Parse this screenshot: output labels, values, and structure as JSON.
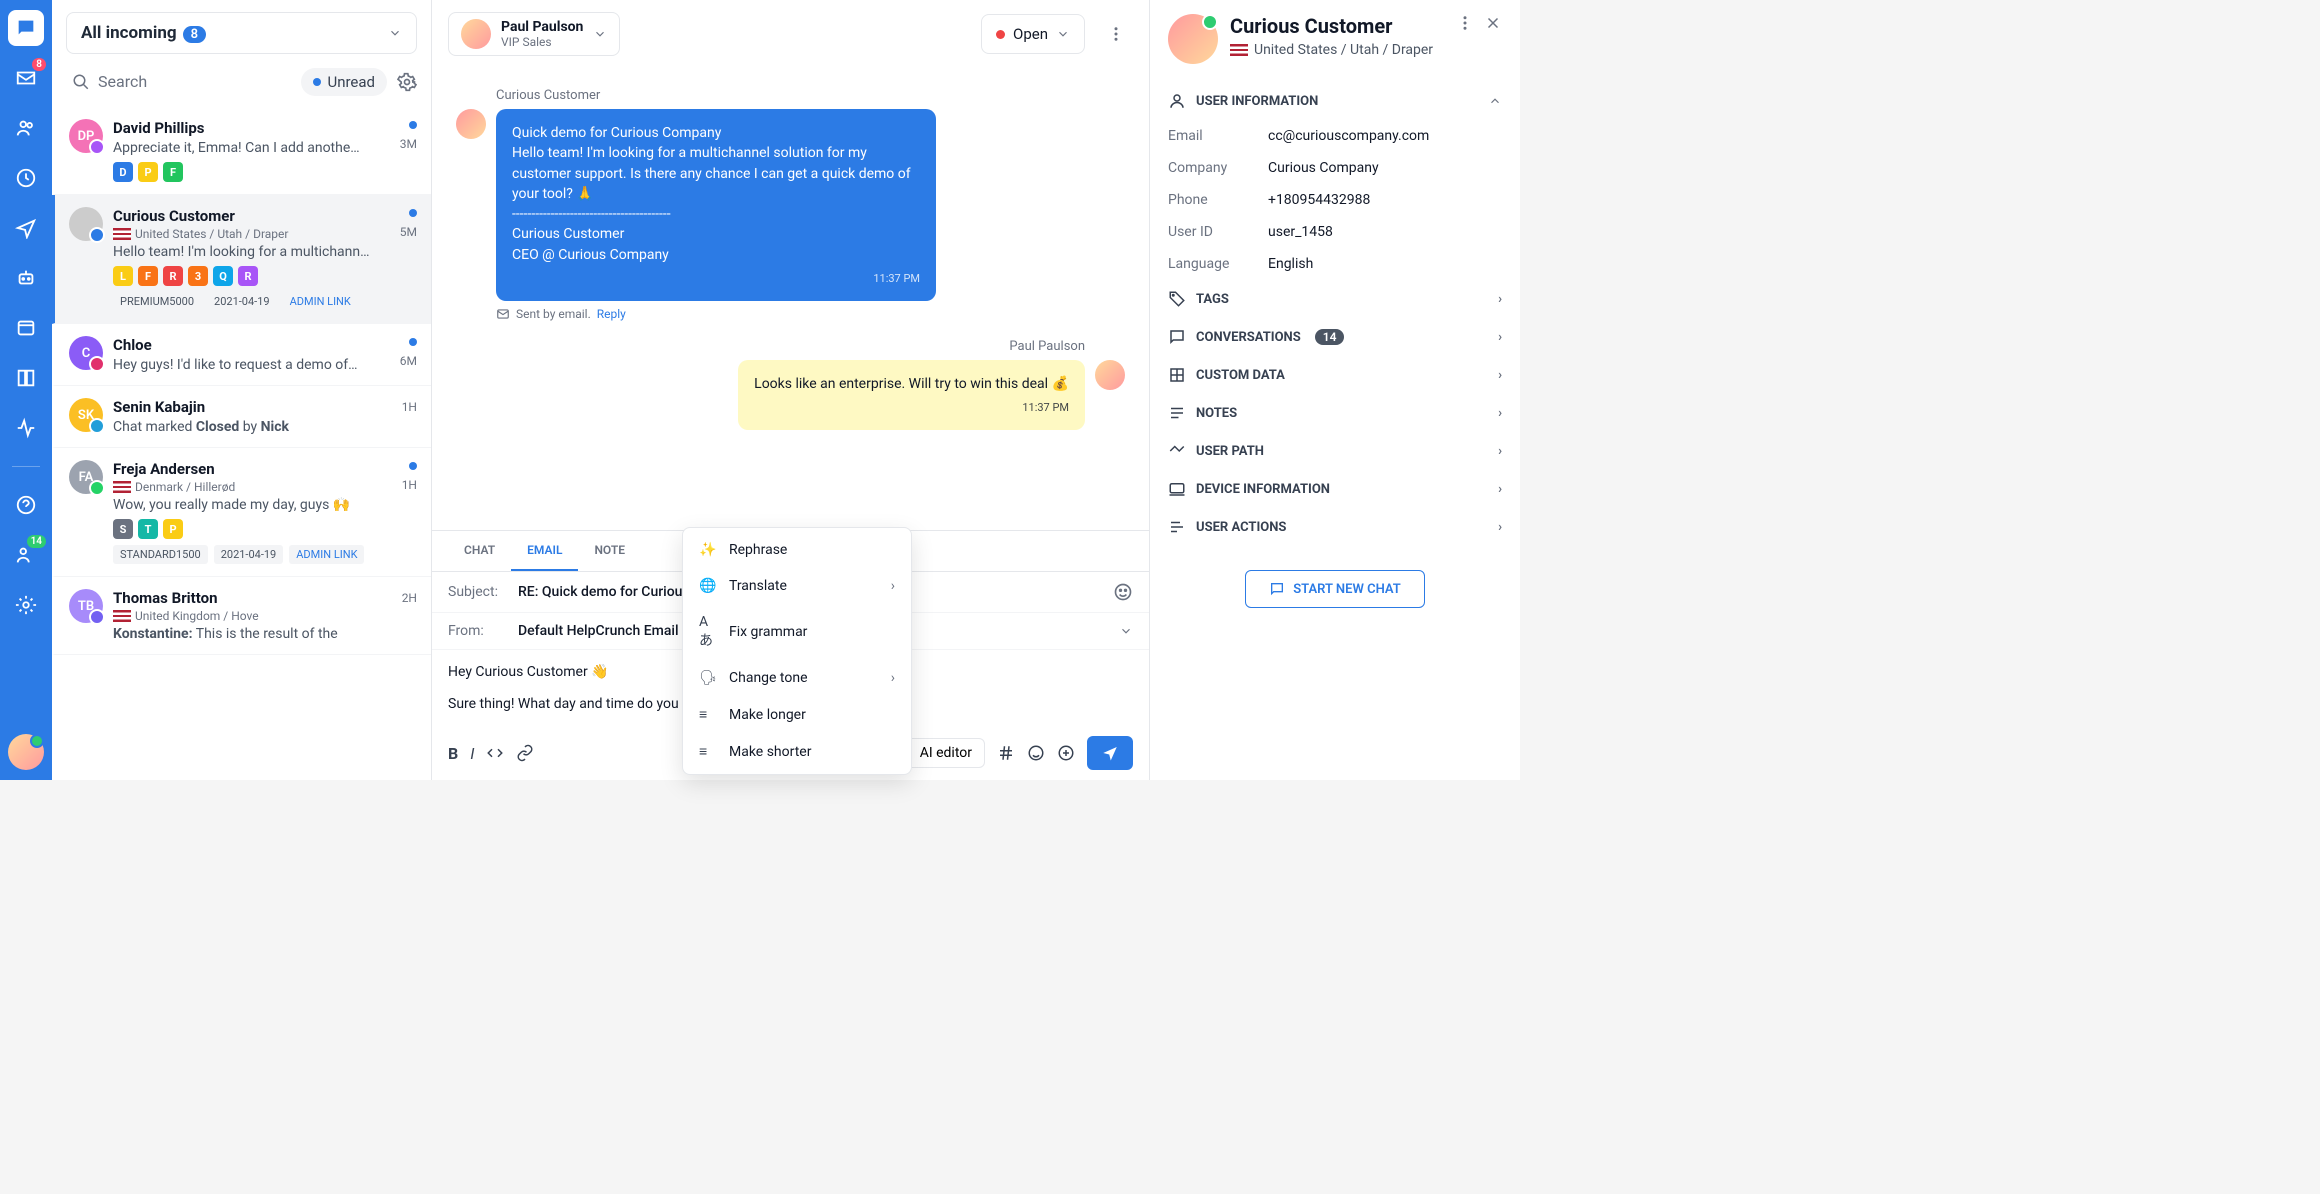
{
  "rail": {
    "inbox_badge": "8",
    "team_badge": "14"
  },
  "inbox": {
    "filter_label": "All incoming",
    "filter_count": "8",
    "search_placeholder": "Search",
    "unread_label": "Unread"
  },
  "conversations": [
    {
      "name": "David Phillips",
      "preview": "Appreciate it, Emma! Can I add anothe…",
      "time": "3M",
      "unread": true,
      "tags": [
        {
          "t": "D",
          "c": "#2c7be5"
        },
        {
          "t": "P",
          "c": "#facc15"
        },
        {
          "t": "F",
          "c": "#22c55e"
        }
      ],
      "av_bg": "#f472b6",
      "av_txt": "DP",
      "channel": "#a855f7"
    },
    {
      "name": "Curious Customer",
      "location": "United States / Utah / Draper",
      "preview": "Hello team! I'm looking for a multichann…",
      "time": "5M",
      "unread": true,
      "selected": true,
      "tags": [
        {
          "t": "L",
          "c": "#facc15"
        },
        {
          "t": "F",
          "c": "#f97316"
        },
        {
          "t": "R",
          "c": "#ef4444"
        },
        {
          "t": "3",
          "c": "#f97316"
        },
        {
          "t": "Q",
          "c": "#0ea5e9"
        },
        {
          "t": "R",
          "c": "#a855f7"
        }
      ],
      "chips": [
        "PREMIUM5000",
        "2021-04-19"
      ],
      "chip_link": "ADMIN LINK",
      "av_img": true,
      "channel": "#2c7be5"
    },
    {
      "name": "Chloe",
      "preview": "Hey guys! I'd like to request a demo of…",
      "time": "6M",
      "unread": true,
      "av_bg": "#8b5cf6",
      "av_txt": "C",
      "channel": "#e1306c"
    },
    {
      "name": "Senin Kabajin",
      "preview_html": "Chat marked <b>Closed</b> by <b>Nick</b>",
      "time": "1H",
      "av_bg": "#fbbf24",
      "av_txt": "SK",
      "channel": "#229ed9"
    },
    {
      "name": "Freja Andersen",
      "location": "Denmark / Hillerød",
      "preview": "Wow, you really made my day, guys 🙌",
      "time": "1H",
      "unread": true,
      "tags": [
        {
          "t": "S",
          "c": "#6b7280"
        },
        {
          "t": "T",
          "c": "#14b8a6"
        },
        {
          "t": "P",
          "c": "#facc15"
        }
      ],
      "chips": [
        "STANDARD1500",
        "2021-04-19"
      ],
      "chip_link": "ADMIN LINK",
      "av_bg": "#9ca3af",
      "av_txt": "FA",
      "channel": "#25d366",
      "flag": "dk"
    },
    {
      "name": "Thomas Britton",
      "location": "United Kingdom / Hove",
      "preview_html": "<b>Konstantine:</b> This is the result of the",
      "time": "2H",
      "av_bg": "#a78bfa",
      "av_txt": "TB",
      "channel": "#7360f2",
      "flag": "uk"
    }
  ],
  "chat": {
    "assignee_name": "Paul Paulson",
    "assignee_sub": "VIP Sales",
    "status": "Open",
    "msg1_sender": "Curious Customer",
    "msg1_body": "Quick demo for Curious Company\nHello team! I'm looking for a multichannel solution for my customer support. Is there any chance I can get a quick demo of your tool? 🙏\n-----------------------------------------\nCurious Customer\nCEO @ Curious Company",
    "msg1_time": "11:37 PM",
    "sent_by_label": "Sent by email.",
    "reply_label": "Reply",
    "msg2_sender": "Paul Paulson",
    "msg2_body": "Looks like an enterprise. Will try to win this deal 💰",
    "msg2_time": "11:37 PM"
  },
  "composer": {
    "tab_chat": "CHAT",
    "tab_email": "EMAIL",
    "tab_note": "NOTE",
    "subject_label": "Subject:",
    "subject_value": "RE: Quick demo for Curious",
    "from_label": "From:",
    "from_value": "Default HelpCrunch Email A",
    "body": "Hey Curious Customer 👋\n\nSure thing! What day and time do you",
    "ai_editor_label": "AI editor",
    "ai_menu": [
      "Rephrase",
      "Translate",
      "Fix grammar",
      "Change tone",
      "Make longer",
      "Make shorter"
    ]
  },
  "details": {
    "name": "Curious Customer",
    "location": "United States / Utah / Draper",
    "sec_user_info": "USER INFORMATION",
    "info": {
      "Email": "cc@curiouscompany.com",
      "Company": "Curious Company",
      "Phone": "+180954432988",
      "User ID": "user_1458",
      "Language": "English"
    },
    "sec_tags": "TAGS",
    "sec_conversations": "CONVERSATIONS",
    "conv_count": "14",
    "sec_custom": "CUSTOM DATA",
    "sec_notes": "NOTES",
    "sec_path": "USER PATH",
    "sec_device": "DEVICE INFORMATION",
    "sec_actions": "USER ACTIONS",
    "start_chat": "START NEW CHAT"
  }
}
